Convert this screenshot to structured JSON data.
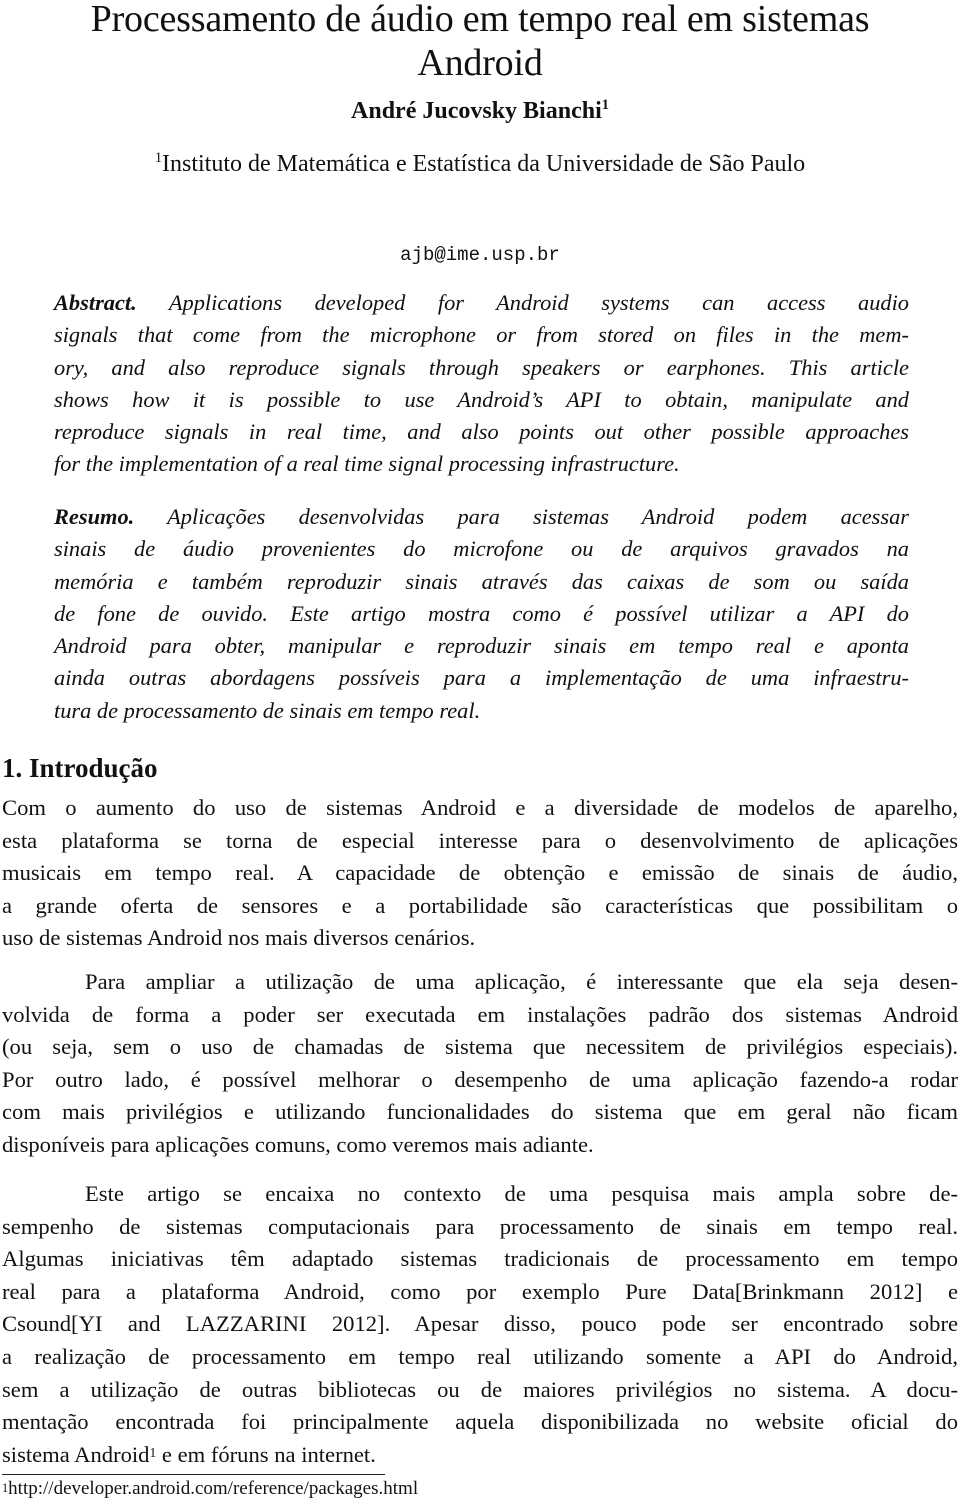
{
  "paper": {
    "title_lines": [
      "Processamento de áudio em tempo real em sistemas",
      "Android"
    ],
    "author": "André Jucovsky Bianchi",
    "author_mark": "1",
    "affiliation_mark": "1",
    "affiliation": "Instituto de Matemática e Estatística da Universidade de São Paulo",
    "email": "ajb@ime.usp.br"
  },
  "abstract": {
    "label": "Abstract.",
    "lines": [
      " Applications developed for Android systems can access audio",
      "signals that come from the microphone or from stored on files in the mem-",
      "ory, and also reproduce signals through speakers or earphones. This article",
      "shows how it is possible to use Android’s API to obtain, manipulate and",
      "reproduce signals in real time, and also points out other possible approaches",
      "for the implementation of a real time signal processing infrastructure."
    ]
  },
  "resumo": {
    "label": "Resumo.",
    "lines": [
      " Aplicações desenvolvidas para sistemas Android podem acessar",
      "sinais de áudio provenientes do microfone ou de arquivos gravados na",
      "memória e também reproduzir sinais através das caixas de som ou saída",
      "de fone de ouvido. Este artigo mostra como é possível utilizar a API do",
      "Android para obter, manipular e reproduzir sinais em tempo real e aponta",
      "ainda outras abordagens possíveis para a implementação de uma infraestru-",
      "tura de processamento de sinais em tempo real."
    ]
  },
  "section": {
    "number": "1.",
    "title": "Introdução"
  },
  "paragraphs": [
    {
      "lines": [
        "Com o aumento do uso de sistemas Android e a diversidade de modelos de aparelho,",
        "esta plataforma se torna de especial interesse para o desenvolvimento de aplicações",
        "musicais em tempo real. A capacidade de obtenção e emissão de sinais de áudio,",
        "a grande oferta de sensores e a portabilidade são características que possibilitam o",
        "uso de sistemas Android nos mais diversos cenários."
      ]
    },
    {
      "lines": [
        "Para ampliar a utilização de uma aplicação, é interessante que ela seja desen-",
        "volvida de forma a poder ser executada em instalações padrão dos sistemas Android",
        "(ou seja, sem o uso de chamadas de sistema que necessitem de privilégios especiais).",
        "Por outro lado, é possível melhorar o desempenho de uma aplicação fazendo-a rodar",
        "com mais privilégios e utilizando funcionalidades do sistema que em geral não ficam",
        "disponíveis para aplicações comuns, como veremos mais adiante."
      ]
    },
    {
      "lines": [
        "Este artigo se encaixa no contexto de uma pesquisa mais ampla sobre de-",
        "sempenho de sistemas computacionais para processamento de sinais em tempo real.",
        "Algumas iniciativas têm adaptado sistemas tradicionais de processamento em tempo",
        "real para a plataforma Android, como por exemplo Pure Data[Brinkmann 2012] e",
        "Csound[YI and LAZZARINI 2012]. Apesar disso, pouco pode ser encontrado sobre",
        "a realização de processamento em tempo real utilizando somente a API do Android,",
        "sem a utilização de outras bibliotecas ou de maiores privilégios no sistema. A docu-",
        "mentação encontrada foi principalmente aquela disponibilizada no website oficial do"
      ],
      "last_line_before_mark": "sistema Android",
      "footnote_mark": "1",
      "last_line_after_mark": " e em fóruns na internet."
    }
  ],
  "footnote": {
    "mark": "1",
    "text": "http://developer.android.com/reference/packages.html"
  }
}
